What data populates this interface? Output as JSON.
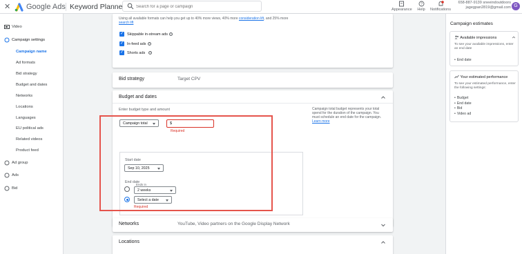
{
  "topbar": {
    "close": "✕",
    "brand": "Google Ads",
    "tool": "Keyword Planner",
    "search_placeholder": "Search for a page or campaign",
    "appearance": "Appearance",
    "help": "Help",
    "notifications": "Notifications",
    "notif_count": "1",
    "account_line1": "658-887-9139 sneeindoutdoors",
    "account_line2": "jagegpan2819@gmail.com",
    "avatar_letter": "G",
    "brand_colors": {
      "blue": "#4285f4",
      "yellow": "#fbbc04",
      "green": "#34a853"
    }
  },
  "sidebar": {
    "video": "Video",
    "campaign_settings": "Campaign settings",
    "sub_items": [
      "Campaign name",
      "Ad formats",
      "Bid strategy",
      "Budget and dates",
      "Networks",
      "Locations",
      "Languages",
      "EU political ads",
      "Related videos",
      "Product feed"
    ],
    "active_sub": "Campaign name",
    "ad_group": "Ad group",
    "ads": "Ads",
    "bid": "Bid"
  },
  "ad_formats": {
    "info_before": "Using all available formats can help you get up to 40% more views, 40% more ",
    "info_link1": "consideration lift",
    "info_mid": ", and 25% more ",
    "info_link2": "search lift",
    "checkboxes": [
      "Skippable in-stream ads",
      "In-feed ads",
      "Shorts ads"
    ]
  },
  "bid_strategy": {
    "title": "Bid strategy",
    "value": "Target CPV"
  },
  "budget": {
    "title": "Budget and dates",
    "type_label": "Enter budget type and amount",
    "type_value": "Campaign total",
    "amount_prefix": "$",
    "required": "Required",
    "info_text": "Campaign total budget represents your total spend for the duration of the campaign. You must schedule an end date for the campaign.",
    "learn_more": "Learn more",
    "start_date_label": "Start date",
    "start_date_value": "Sep 10, 2025",
    "end_date_label": "End date",
    "ends_in_label": "Ends in",
    "ends_in_value": "2 weeks",
    "select_date": "Select a date",
    "select_required": "Required"
  },
  "networks": {
    "title": "Networks",
    "value": "YouTube, Video partners on the Google Display Network"
  },
  "locations": {
    "title": "Locations"
  },
  "right_panel": {
    "title": "Campaign estimates",
    "card1_title": "Available impressions",
    "card1_body": "To see your available impressions, enter an end date",
    "card1_items": [
      "End date"
    ],
    "card2_title": "Your estimated performance",
    "card2_body": "To see your estimated performance, enter the following settings:",
    "card2_items": [
      "Budget",
      "End date",
      "Bid",
      "Video ad"
    ]
  }
}
